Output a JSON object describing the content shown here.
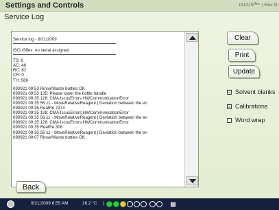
{
  "header": {
    "title": "Settings and Controls",
    "brand": "ISCUS",
    "brand_sup": "flex",
    "brand_suffix": "| Rev D"
  },
  "subtitle": "Service Log",
  "log": {
    "header_line": "Service log - 9/21/2009",
    "serial_line": "ISCUSflex: no serial assigned",
    "stats": [
      "TS: 8",
      "AC: 46",
      "RC: 82",
      "CR: 0",
      "TH: 58h"
    ],
    "entries": [
      "090921 09:53 Rinse/Waste bottles OK",
      "090921 09:53 135: Please lower the bottle handle",
      "090921 09:35 128: CMA.IscusErrors.HWCommunicationError",
      "090921 09:35 56 11 - MoveRelativeReagent | Deviation between the en",
      "090921 09:35 RealRe 7374",
      "090921 09:35 128: CMA.IscusErrors.HWCommunicationError",
      "090921 09:35 56 11 - MoveRelativeReagent | Deviation between the en",
      "090921 09:35 128: CMA.IscusErrors.HWCommunicationError",
      "090921 09:35 RealRe 308",
      "090921 09:35 56 11 - MoveRelativeReagent | Deviation between the en",
      "090921 09:07 Rinse/Waste bottles OK"
    ]
  },
  "buttons": {
    "clear": "Clear",
    "print": "Print",
    "update": "Update",
    "back": "Back"
  },
  "options": {
    "solvent_blanks": {
      "label": "Solvent blanks",
      "checked": true,
      "mark": "☑"
    },
    "calibrations": {
      "label": "Calibrations",
      "checked": true,
      "mark": "☑"
    },
    "word_wrap": {
      "label": "Word wrap",
      "checked": false,
      "mark": ""
    }
  },
  "status": {
    "datetime": "9/21/2009 8:55 AM",
    "temperature": "26.2 °C",
    "separator": "|",
    "indicators": [
      "green",
      "green",
      "yellow",
      "white",
      "white",
      "white",
      "white",
      "white"
    ]
  }
}
